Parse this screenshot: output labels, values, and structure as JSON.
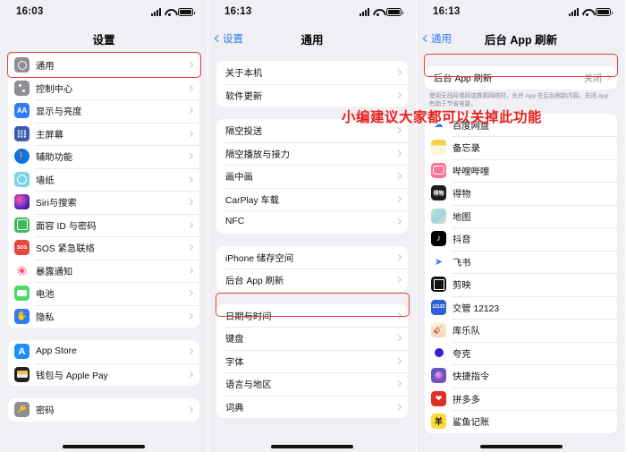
{
  "panel1": {
    "status": {
      "time": "16:03"
    },
    "nav": {
      "title": "设置"
    },
    "groups": [
      {
        "items": [
          {
            "label": "通用",
            "icon": "gear-icon",
            "highlighted": true
          },
          {
            "label": "控制中心",
            "icon": "control-center-icon"
          },
          {
            "label": "显示与亮度",
            "icon": "display-brightness-icon"
          },
          {
            "label": "主屏幕",
            "icon": "home-screen-icon"
          },
          {
            "label": "辅助功能",
            "icon": "accessibility-icon"
          },
          {
            "label": "墙纸",
            "icon": "wallpaper-icon"
          },
          {
            "label": "Siri与搜索",
            "icon": "siri-icon"
          },
          {
            "label": "面容 ID 与密码",
            "icon": "face-id-icon"
          },
          {
            "label": "SOS 紧急联络",
            "icon": "sos-icon"
          },
          {
            "label": "暴露通知",
            "icon": "exposure-notification-icon"
          },
          {
            "label": "电池",
            "icon": "battery-icon"
          },
          {
            "label": "隐私",
            "icon": "privacy-icon"
          }
        ]
      },
      {
        "items": [
          {
            "label": "App Store",
            "icon": "app-store-icon"
          },
          {
            "label": "钱包与 Apple Pay",
            "icon": "wallet-icon"
          }
        ]
      },
      {
        "items": [
          {
            "label": "密码",
            "icon": "passwords-icon"
          }
        ]
      }
    ]
  },
  "panel2": {
    "status": {
      "time": "16:13"
    },
    "nav": {
      "back": "设置",
      "title": "通用"
    },
    "groups": [
      {
        "items": [
          {
            "label": "关于本机"
          },
          {
            "label": "软件更新"
          }
        ]
      },
      {
        "items": [
          {
            "label": "隔空投送"
          },
          {
            "label": "隔空播放与接力"
          },
          {
            "label": "画中画"
          },
          {
            "label": "CarPlay 车载"
          },
          {
            "label": "NFC"
          }
        ]
      },
      {
        "items": [
          {
            "label": "iPhone 储存空间"
          },
          {
            "label": "后台 App 刷新",
            "highlighted": true
          }
        ]
      },
      {
        "items": [
          {
            "label": "日期与时间"
          },
          {
            "label": "键盘"
          },
          {
            "label": "字体"
          },
          {
            "label": "语言与地区"
          },
          {
            "label": "词典"
          }
        ]
      }
    ]
  },
  "panel3": {
    "status": {
      "time": "16:13"
    },
    "nav": {
      "back": "通用",
      "title": "后台 App 刷新"
    },
    "toggle_row": {
      "label": "后台 App 刷新",
      "value": "关闭",
      "highlighted": true
    },
    "description": "使用无线局域网或蜂窝网络时，允许 App 在后台刷新内容。关闭 App 有助于节省电量。",
    "annotation": "小编建议大家都可以关掉此功能",
    "annotation_color": "#e8201b",
    "apps": [
      {
        "label": "百度网盘",
        "icon": "baidu-netdisk-icon"
      },
      {
        "label": "备忘录",
        "icon": "notes-icon"
      },
      {
        "label": "哔哩哔哩",
        "icon": "bilibili-icon"
      },
      {
        "label": "得物",
        "icon": "dewu-icon"
      },
      {
        "label": "地图",
        "icon": "maps-icon"
      },
      {
        "label": "抖音",
        "icon": "douyin-icon"
      },
      {
        "label": "飞书",
        "icon": "feishu-icon"
      },
      {
        "label": "剪映",
        "icon": "jianying-icon"
      },
      {
        "label": "交管 12123",
        "icon": "jiaoguan-12123-icon"
      },
      {
        "label": "库乐队",
        "icon": "garageband-icon"
      },
      {
        "label": "夸克",
        "icon": "quark-icon"
      },
      {
        "label": "快捷指令",
        "icon": "shortcuts-icon"
      },
      {
        "label": "拼多多",
        "icon": "pinduoduo-icon"
      },
      {
        "label": "鲨鱼记账",
        "icon": "shark-accounting-icon"
      }
    ]
  }
}
